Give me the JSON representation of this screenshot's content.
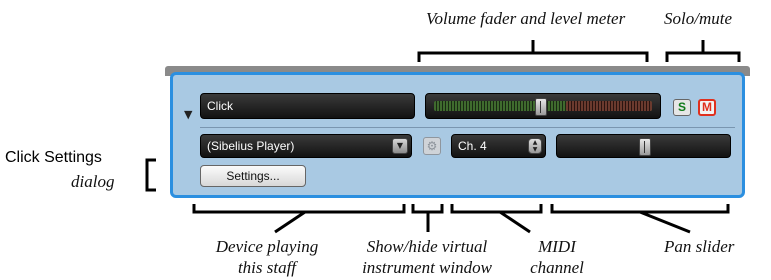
{
  "annotations": {
    "volume_fader": "Volume fader and level meter",
    "solo_mute": "Solo/mute",
    "click_settings": "Click Settings",
    "dialog": "dialog",
    "device_line1": "Device playing",
    "device_line2": "this staff",
    "showhide_line1": "Show/hide virtual",
    "showhide_line2": "instrument window",
    "midi_line1": "MIDI",
    "midi_line2": "channel",
    "pan_slider": "Pan slider"
  },
  "mixer_strip": {
    "staff_name": "Click",
    "device": "(Sibelius Player)",
    "channel": "Ch. 4",
    "settings_label": "Settings...",
    "solo_label": "S",
    "mute_label": "M",
    "volume_level": 0.5,
    "pan_level": 0.5
  },
  "icons": {
    "expand": "triangle-down-icon",
    "dropdown": "chevron-down-icon",
    "virtual_instrument": "gear-icon",
    "channel_spinner": "spinner-icon"
  },
  "colors": {
    "panel_background": "#a9c9e3",
    "panel_border": "#2b8fe0",
    "solo": "#107a1a",
    "mute": "#e0301e"
  }
}
